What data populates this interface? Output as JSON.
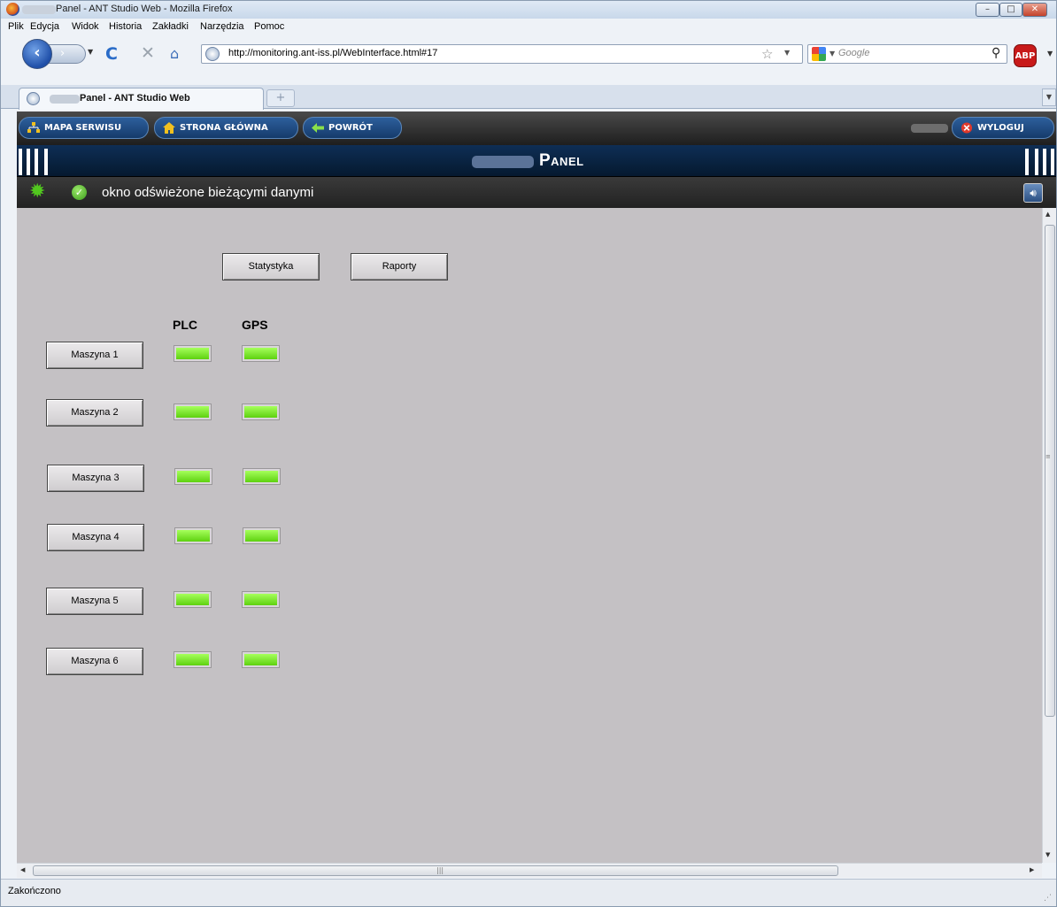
{
  "window": {
    "title": "Panel - ANT Studio Web - Mozilla Firefox",
    "min": "–",
    "max": "□",
    "close": "✕"
  },
  "menu": [
    "Plik",
    "Edycja",
    "Widok",
    "Historia",
    "Zakładki",
    "Narzędzia",
    "Pomoc"
  ],
  "nav": {
    "url": "http://monitoring.ant-iss.pl/WebInterface.html#17",
    "search_placeholder": "Google"
  },
  "tabs": [
    {
      "label": "Panel - ANT Studio Web"
    }
  ],
  "app_toolbar": {
    "map": "MAPA SERWISU",
    "home": "STRONA GŁÓWNA",
    "back": "POWRÓT",
    "logout": "WYLOGUJ"
  },
  "panel": {
    "title": "Panel"
  },
  "status": {
    "text": "okno odświeżone bieżącymi danymi"
  },
  "content": {
    "buttons": {
      "stats": "Statystyka",
      "reports": "Raporty"
    },
    "columns": {
      "plc": "PLC",
      "gps": "GPS"
    },
    "machines": [
      {
        "label": "Maszyna 1",
        "plc": "ok",
        "gps": "ok"
      },
      {
        "label": "Maszyna 2",
        "plc": "ok",
        "gps": "ok"
      },
      {
        "label": "Maszyna 3",
        "plc": "ok",
        "gps": "ok"
      },
      {
        "label": "Maszyna 4",
        "plc": "ok",
        "gps": "ok"
      },
      {
        "label": "Maszyna 5",
        "plc": "ok",
        "gps": "ok"
      },
      {
        "label": "Maszyna 6",
        "plc": "ok",
        "gps": "ok"
      }
    ],
    "led_color_ok": "#7cf02a"
  },
  "browser_status": "Zakończono",
  "icons": {
    "gear": "gear-icon",
    "ok": "check-icon",
    "sound": "speaker-icon"
  }
}
